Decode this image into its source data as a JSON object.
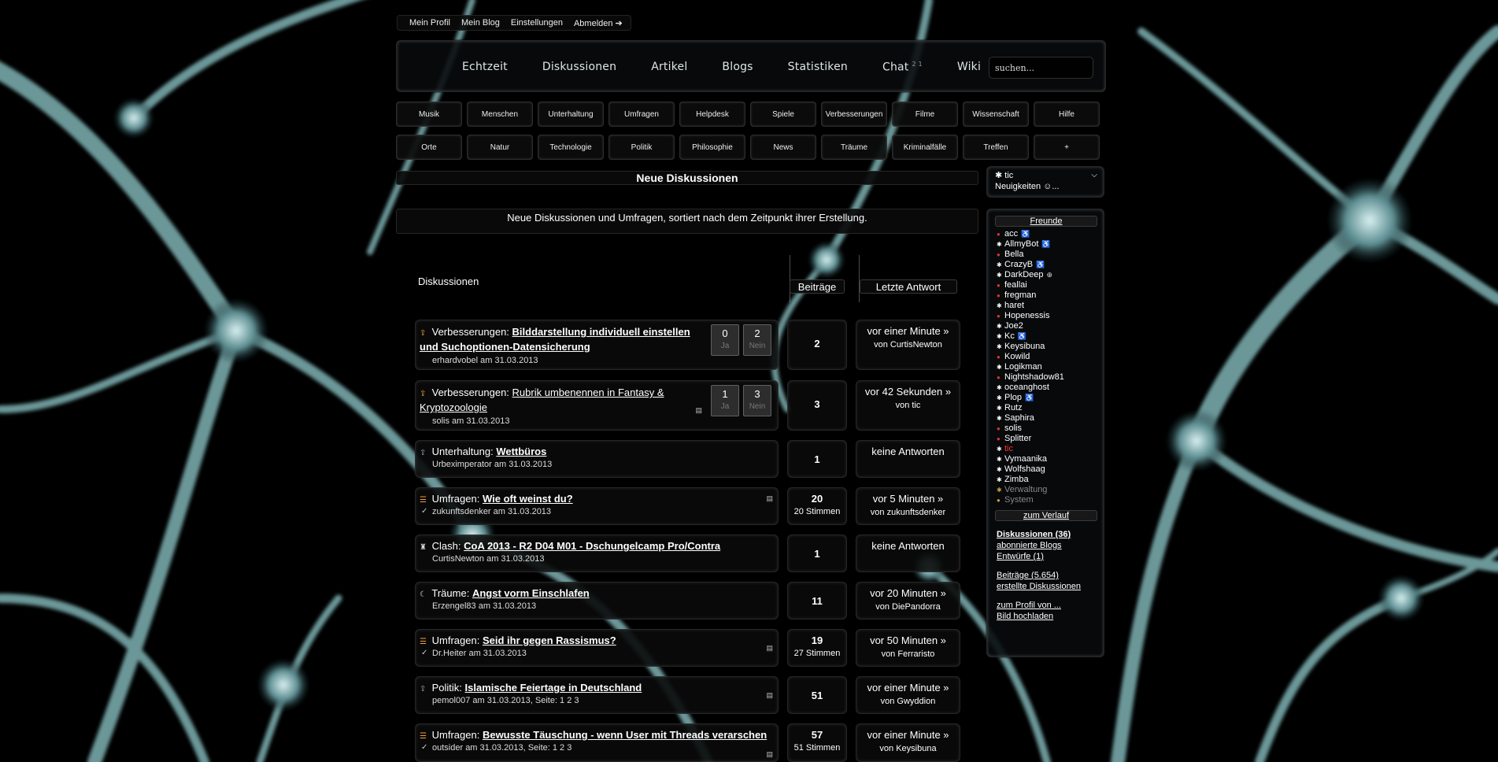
{
  "usermenu": {
    "items": [
      "Mein Profil",
      "Mein Blog",
      "Einstellungen",
      "Abmelden ➔"
    ]
  },
  "mainnav": {
    "links": [
      "Echtzeit",
      "Diskussionen",
      "Artikel",
      "Blogs",
      "Statistiken",
      "Chat",
      "Wiki"
    ],
    "chat_badge": "2 1",
    "search_placeholder": "suchen..."
  },
  "categories": {
    "row1": [
      "Musik",
      "Menschen",
      "Unterhaltung",
      "Umfragen",
      "Helpdesk",
      "Spiele",
      "Verbesserungen",
      "Filme",
      "Wissenschaft",
      "Hilfe"
    ],
    "row2": [
      "Orte",
      "Natur",
      "Technologie",
      "Politik",
      "Philosophie",
      "News",
      "Träume",
      "Kriminalfälle",
      "Treffen",
      "+"
    ]
  },
  "page": {
    "title": "Neue Diskussionen",
    "description": "Neue Diskussionen und Umfragen, sortiert nach dem Zeitpunkt ihrer Erstellung."
  },
  "table": {
    "col_discussions": "Diskussionen",
    "col_posts": "Beiträge",
    "col_last": "Letzte Antwort"
  },
  "threads": [
    {
      "category": "Verbesserungen:",
      "title": "Bilddarstellung individuell einstellen und Suchoptionen-Datensicherung",
      "meta": "erhardvobel am 31.03.2013",
      "yes": "0",
      "no": "2",
      "yes_label": "Ja",
      "no_label": "Nein",
      "posts": "2",
      "last": "vor einer Minute »",
      "last_by": "von CurtisNewton"
    },
    {
      "category": "Verbesserungen:",
      "title": "Rubrik umbenennen in Fantasy & Kryptozoologie",
      "meta": "solis am 31.03.2013",
      "yes": "1",
      "no": "3",
      "yes_label": "Ja",
      "no_label": "Nein",
      "posts": "3",
      "last": "vor 42 Sekunden »",
      "last_by": "von tic"
    },
    {
      "category": "Unterhaltung:",
      "title": "Wettbüros",
      "meta": "Urbeximperator am 31.03.2013",
      "posts": "1",
      "last": "keine Antworten",
      "last_by": ""
    },
    {
      "category": "Umfragen:",
      "title": "Wie oft weinst du?",
      "meta": "zukunftsdenker am 31.03.2013",
      "posts": "20",
      "votes": "20 Stimmen",
      "last": "vor 5 Minuten »",
      "last_by": "von zukunftsdenker"
    },
    {
      "category": "Clash:",
      "title": "CoA 2013 - R2 D04 M01 - Dschungelcamp Pro/Contra",
      "meta": "CurtisNewton am 31.03.2013",
      "posts": "1",
      "last": "keine Antworten",
      "last_by": ""
    },
    {
      "category": "Träume:",
      "title": "Angst vorm Einschlafen",
      "meta": "Erzengel83 am 31.03.2013",
      "posts": "11",
      "last": "vor 20 Minuten »",
      "last_by": "von DiePandorra"
    },
    {
      "category": "Umfragen:",
      "title": "Seid ihr gegen Rassismus?",
      "meta": "Dr.Heiter am 31.03.2013",
      "posts": "19",
      "votes": "27 Stimmen",
      "last": "vor 50 Minuten »",
      "last_by": "von Ferraristo"
    },
    {
      "category": "Politik:",
      "title": "Islamische Feiertage in Deutschland",
      "meta": "pemol007 am 31.03.2013, Seite: 1 2 3",
      "posts": "51",
      "last": "vor einer Minute »",
      "last_by": "von Gwyddion"
    },
    {
      "category": "Umfragen:",
      "title": "Bewusste Täuschung - wenn User mit Threads verarschen",
      "meta": "outsider am 31.03.2013, Seite: 1 2 3",
      "posts": "57",
      "votes": "51 Stimmen",
      "last": "vor einer Minute »",
      "last_by": "von Keysibuna"
    }
  ],
  "sidebar": {
    "user": "tic",
    "status": "Neuigkeiten ☺...",
    "friends_label": "Freunde",
    "friends": [
      {
        "name": "acc",
        "on": false,
        "extra": "♿"
      },
      {
        "name": "AllmyBot",
        "on": true,
        "extra": "♿"
      },
      {
        "name": "Bella",
        "on": false,
        "extra": ""
      },
      {
        "name": "CrazyB",
        "on": true,
        "extra": "♿"
      },
      {
        "name": "DarkDeep",
        "on": true,
        "extra": "⊕"
      },
      {
        "name": "feallai",
        "on": false,
        "extra": ""
      },
      {
        "name": "fregman",
        "on": false,
        "extra": ""
      },
      {
        "name": "haret",
        "on": true,
        "extra": ""
      },
      {
        "name": "Hopenessis",
        "on": false,
        "extra": ""
      },
      {
        "name": "Joe2",
        "on": true,
        "extra": ""
      },
      {
        "name": "Kc",
        "on": true,
        "extra": "♿"
      },
      {
        "name": "Keysibuna",
        "on": true,
        "extra": ""
      },
      {
        "name": "Kowild",
        "on": false,
        "extra": ""
      },
      {
        "name": "Logikman",
        "on": true,
        "extra": ""
      },
      {
        "name": "Nightshadow81",
        "on": false,
        "extra": ""
      },
      {
        "name": "oceanghost",
        "on": true,
        "extra": ""
      },
      {
        "name": "Plop",
        "on": true,
        "extra": "♿"
      },
      {
        "name": "Rutz",
        "on": true,
        "extra": ""
      },
      {
        "name": "Saphira",
        "on": true,
        "extra": ""
      },
      {
        "name": "solis",
        "on": false,
        "extra": ""
      },
      {
        "name": "Splitter",
        "on": false,
        "extra": ""
      },
      {
        "name": "tic",
        "on": true,
        "extra": "",
        "self": true
      },
      {
        "name": "Vymaanika",
        "on": true,
        "extra": ""
      },
      {
        "name": "Wolfshaag",
        "on": true,
        "extra": ""
      },
      {
        "name": "Zimba",
        "on": true,
        "extra": ""
      },
      {
        "name": "Verwaltung",
        "on": true,
        "extra": "",
        "muted": true
      },
      {
        "name": "System",
        "on": false,
        "extra": "",
        "muted": true
      }
    ],
    "history_label": "zum Verlauf",
    "links1": [
      "Diskussionen (36)",
      "abonnierte Blogs",
      "Entwürfe (1)"
    ],
    "links2": [
      "Beiträge (5.654)",
      "erstellte Diskussionen"
    ],
    "links3": [
      "zum Profil von ...",
      "Bild hochladen"
    ]
  },
  "colors": {
    "self_user": "#ff3333",
    "muted_user": "#888888",
    "accent_icon": "#f0a040"
  }
}
